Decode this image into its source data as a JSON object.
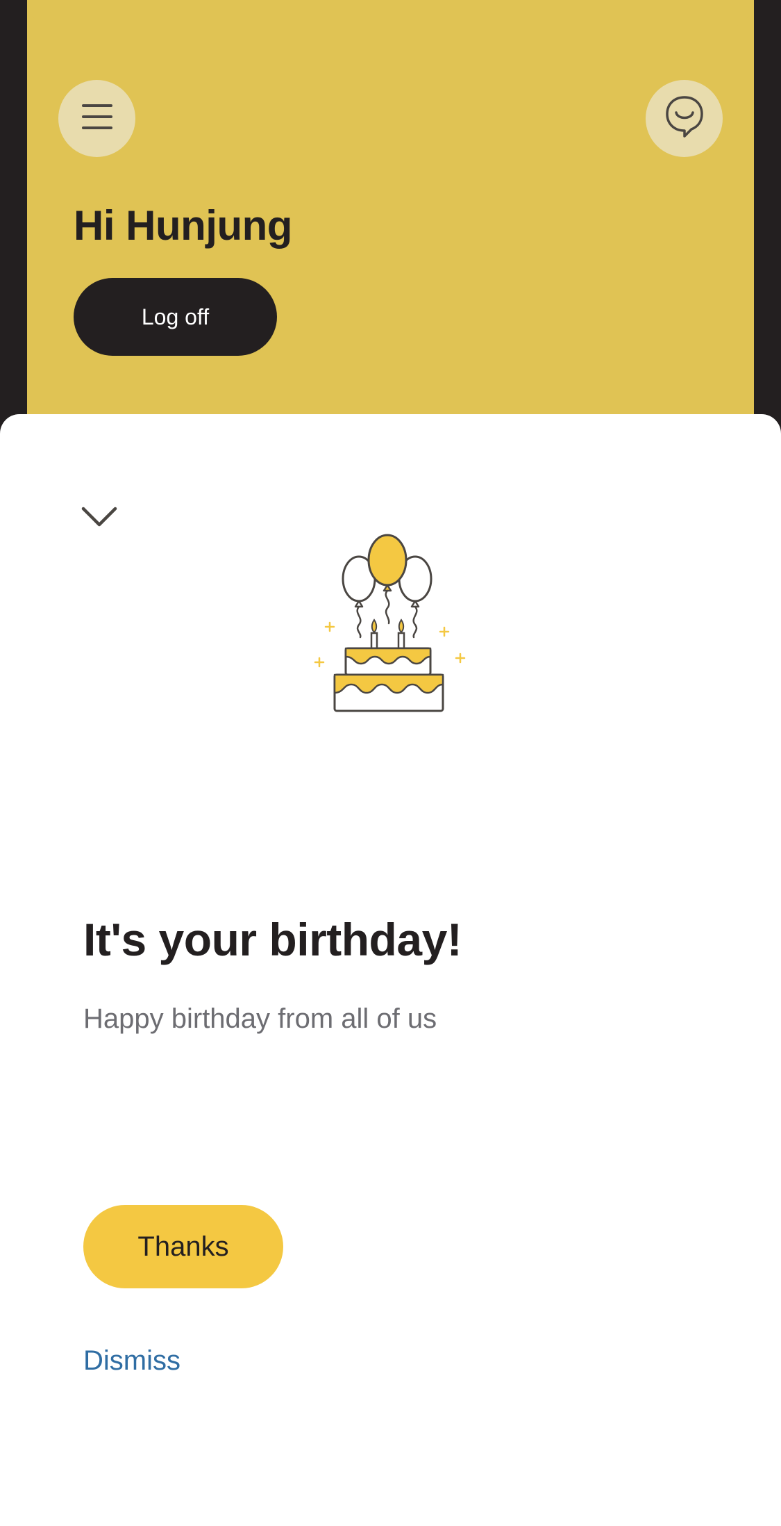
{
  "header": {
    "greeting": "Hi Hunjung",
    "logoff_label": "Log off",
    "menu_icon": "hamburger-menu-icon",
    "chat_icon": "chat-bubble-smile-icon"
  },
  "sheet": {
    "collapse_icon": "chevron-down-icon",
    "illustration": "birthday-cake-balloons-illustration",
    "title": "It's your birthday!",
    "subtitle": "Happy birthday from all of us",
    "thanks_label": "Thanks",
    "dismiss_label": "Dismiss"
  },
  "colors": {
    "header_yellow": "#e0c354",
    "button_yellow": "#f4c842",
    "dark": "#231f20",
    "link_blue": "#2f6da3"
  }
}
